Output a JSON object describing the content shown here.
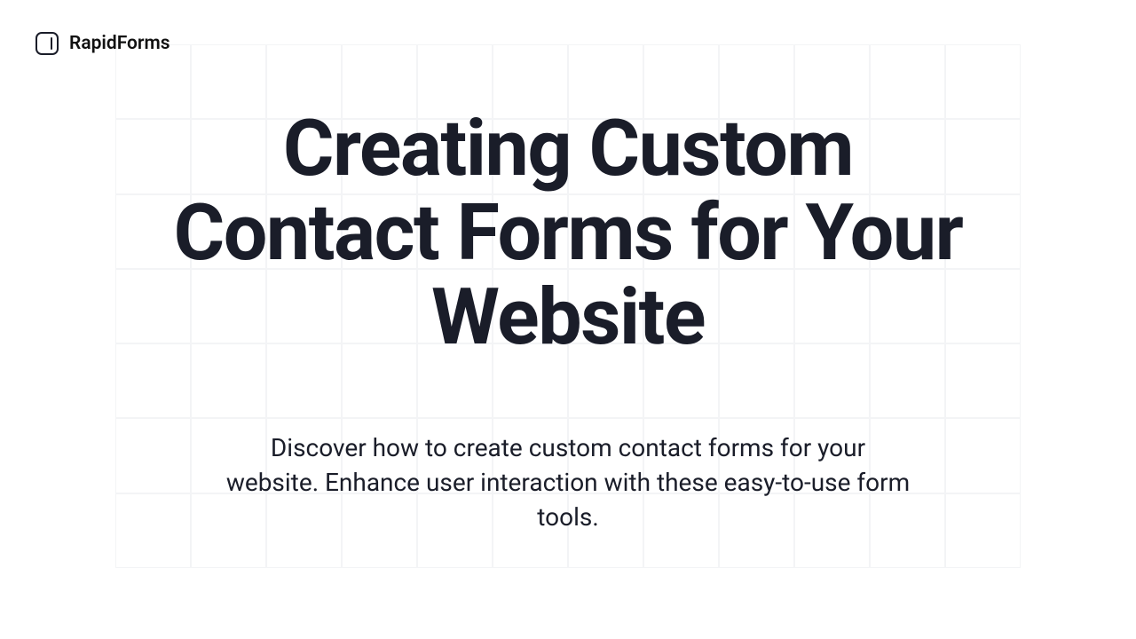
{
  "header": {
    "brand": "RapidForms"
  },
  "main": {
    "title": "Creating Custom Contact Forms for Your Website",
    "subtitle": "Discover how to create custom contact forms for your website. Enhance user interaction with these easy-to-use form tools."
  }
}
